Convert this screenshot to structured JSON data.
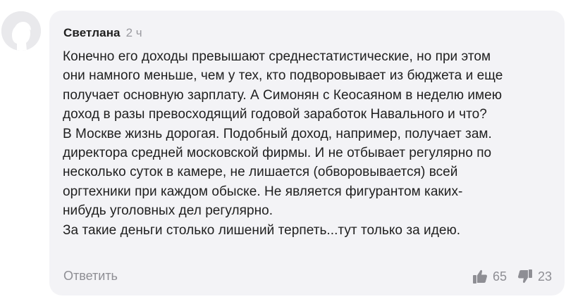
{
  "comment": {
    "author": "Светлана",
    "time": "2 ч",
    "lines": [
      "Конечно его доходы превышают среднестатистические, но при этом",
      "они намного меньше, чем у тех, кто подворовывает из бюджета и еще",
      "получает основную зарплату. А Симонян с Кеосаяном в неделю имею",
      "доход в разы превосходящий годовой заработок Навального и что?",
      "В Москве жизнь дорогая. Подобный доход, например, получает зам.",
      "директора средней московской фирмы. И не отбывает регулярно по",
      "несколько суток в камере, не лишается (обворовывается) всей",
      "оргтехники при каждом обыске. Не является фигурантом каких-",
      "нибудь уголовных дел регулярно.",
      "За такие деньги столько лишений терпеть...тут только за идею."
    ],
    "reply_label": "Ответить",
    "likes": "65",
    "dislikes": "23"
  },
  "icons": {
    "avatar": "user-silhouette-icon",
    "like": "thumbs-up-icon",
    "dislike": "thumbs-down-icon"
  },
  "colors": {
    "bubble_background": "#f3f3f6",
    "text": "#1f1f1f",
    "muted": "#8e8e94"
  }
}
